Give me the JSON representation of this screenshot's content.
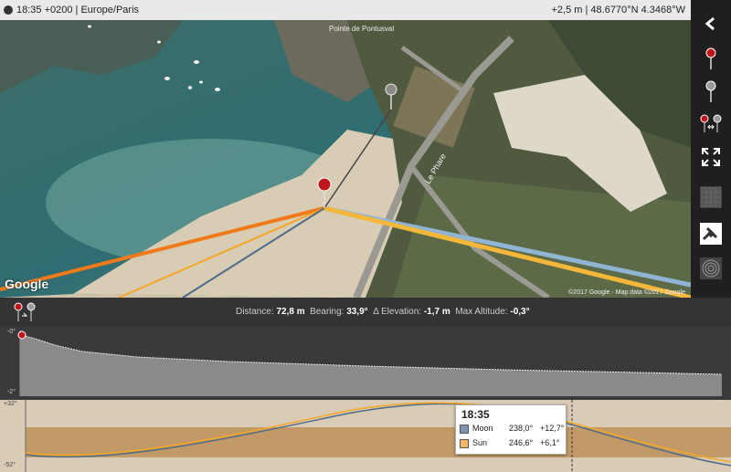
{
  "topbar": {
    "time_zone": "18:35 +0200 | Europe/Paris",
    "position": "+2,5 m | 48.6770°N 4.3468°W"
  },
  "map": {
    "logo": "Google",
    "copyright": "©2017 Google · Map data ©2017 Google",
    "road_label": "Le Phare",
    "place_label": "Pointe de Pontusval"
  },
  "toolbar": {
    "icons": [
      "chevron-left-icon",
      "red-pin-icon",
      "grey-pin-icon",
      "pin-pair-icon",
      "expand-icon",
      "grid-icon",
      "satellite-icon",
      "terrain-icon"
    ]
  },
  "info": {
    "distance_label": "Distance:",
    "distance_value": "72,8 m",
    "bearing_label": "Bearing:",
    "bearing_value": "33,9°",
    "elevation_label": "Δ Elevation:",
    "elevation_value": "-1,7 m",
    "altitude_label": "Max Altitude:",
    "altitude_value": "-0,3°"
  },
  "elevation_profile": {
    "top_label": "-0°",
    "bottom_label": "-2°"
  },
  "sun_moon_chart": {
    "top_label": "+32°",
    "bottom_label": "-52°"
  },
  "tooltip": {
    "time": "18:35",
    "rows": [
      {
        "name": "Moon",
        "azimuth": "238,0°",
        "elevation": "+12,7°",
        "color": "#7f93ac"
      },
      {
        "name": "Sun",
        "azimuth": "246,6°",
        "elevation": "+6,1°",
        "color": "#f2b86a"
      }
    ]
  },
  "colors": {
    "sun_line": "#f5a623",
    "sunset_line": "#f07a1a",
    "moon_line": "#8fb5d3"
  }
}
